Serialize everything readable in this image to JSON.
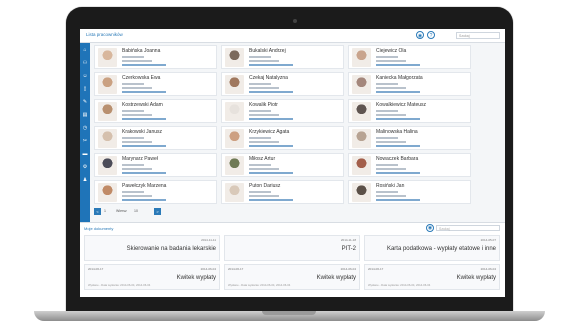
{
  "header": {
    "title": "Lista pracowników",
    "search_placeholder": "Szukaj"
  },
  "sidebar": {
    "icons": [
      "home-icon",
      "org-icon",
      "users-icon",
      "document-icon",
      "edit-icon",
      "form-icon",
      "clock-icon",
      "scissors-icon",
      "card-icon",
      "gear-icon",
      "person-icon"
    ]
  },
  "employees": [
    {
      "name": "Babińska Joanna",
      "photo": "#d8b79d"
    },
    {
      "name": "Bukalski Andrzej",
      "photo": "#7c6a5c"
    },
    {
      "name": "Ciejewicz Ola",
      "photo": "#c9a48d"
    },
    {
      "name": "Czerkowska Ewa",
      "photo": "#caa182"
    },
    {
      "name": "Czekaj Natalyzna",
      "photo": "#a0785e"
    },
    {
      "name": "Kaniecka Małgorzata",
      "photo": "#a4877c"
    },
    {
      "name": "Kostrzewski Adam",
      "photo": "#b9906f"
    },
    {
      "name": "Kowalik Piotr",
      "photo": "#e7e2dd"
    },
    {
      "name": "Kowalkiewicz Mateusz",
      "photo": "#5f5551"
    },
    {
      "name": "Krakowski Janusz",
      "photo": "#d5c0ad"
    },
    {
      "name": "Krzykiewicz Agata",
      "photo": "#cda082"
    },
    {
      "name": "Malinowska Halina",
      "photo": "#b7a393"
    },
    {
      "name": "Marynarz Paweł",
      "photo": "#4c4c58"
    },
    {
      "name": "Miłosz Artur",
      "photo": "#6f7a55"
    },
    {
      "name": "Nowaczek Barbara",
      "photo": "#a35f4b"
    },
    {
      "name": "Pawełczyk Marzena",
      "photo": "#c08a66"
    },
    {
      "name": "Puton Dariusz",
      "photo": "#d9c9b9"
    },
    {
      "name": "Rosiński Jan",
      "photo": "#5b5048"
    }
  ],
  "pager": {
    "prev": "<",
    "page": "1",
    "per_page_label": "Wiersz",
    "per_page": "10",
    "next": ">"
  },
  "documents_section": {
    "title": "Moje dokumenty",
    "search_placeholder": "Szukaj"
  },
  "documents": [
    {
      "date": "2014-11-11",
      "date_left": "",
      "title": "Skierowanie na badania lekarskie",
      "meta": ""
    },
    {
      "date": "2014-11-18",
      "date_left": "",
      "title": "PIT-2",
      "meta": ""
    },
    {
      "date": "2014-05-07",
      "date_left": "",
      "title": "Karta podatkowa - wypłaty etatowe i inne",
      "meta": ""
    },
    {
      "date": "2014-06-04",
      "date_left": "2014-06-17",
      "title": "Kwitek wypłaty",
      "meta": "Wysłane - Data wysłania: 2014-06-04, 2014-06-04"
    },
    {
      "date": "2014-06-04",
      "date_left": "2014-06-17",
      "title": "Kwitek wypłaty",
      "meta": "Wysłane - Data wysłania: 2014-06-04, 2014-06-04"
    },
    {
      "date": "2014-06-04",
      "date_left": "2014-06-17",
      "title": "Kwitek wypłaty",
      "meta": "Wysłane - Data wysłania: 2014-06-04, 2014-06-04"
    }
  ]
}
